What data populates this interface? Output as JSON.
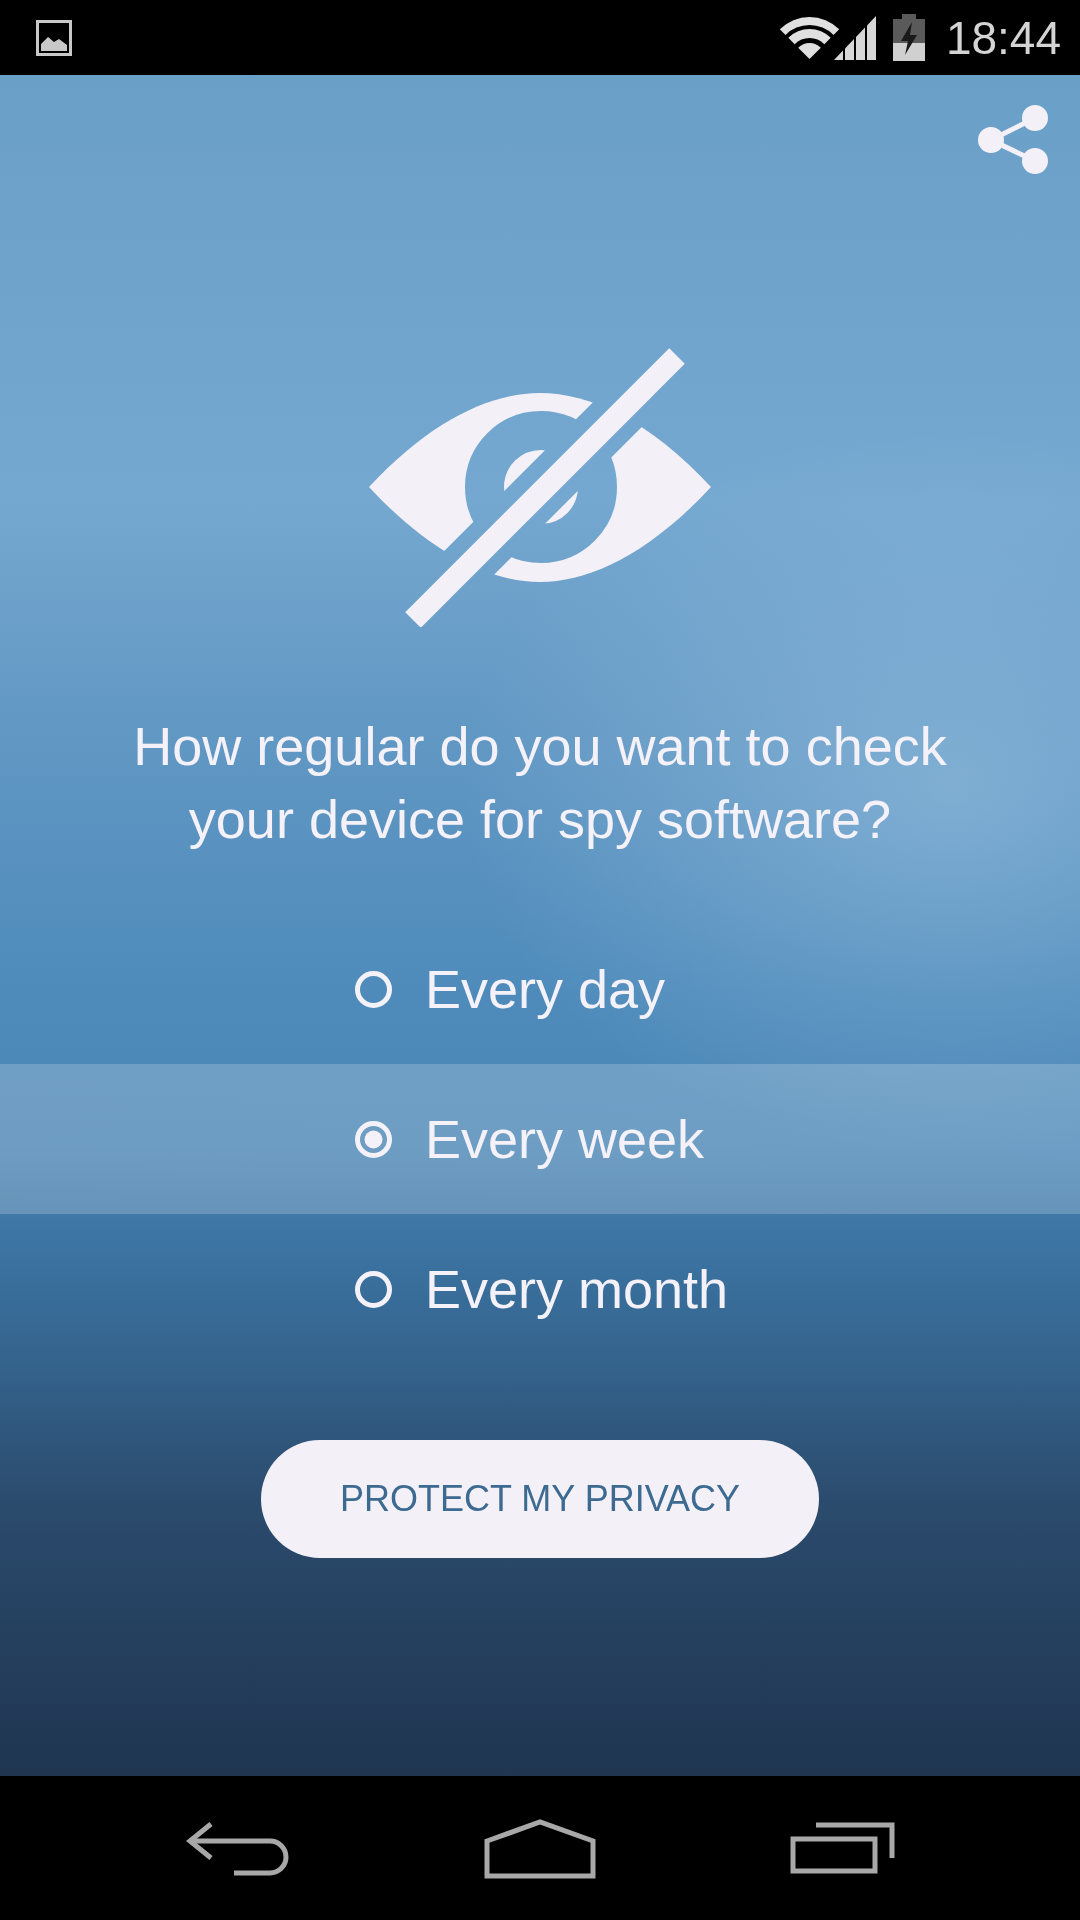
{
  "status_bar": {
    "time": "18:44"
  },
  "question": "How regular do you want to check your device for spy software?",
  "options": [
    {
      "label": "Every day",
      "selected": false
    },
    {
      "label": "Every week",
      "selected": true
    },
    {
      "label": "Every month",
      "selected": false
    }
  ],
  "primary_button": {
    "label": "PROTECT MY PRIVACY"
  }
}
